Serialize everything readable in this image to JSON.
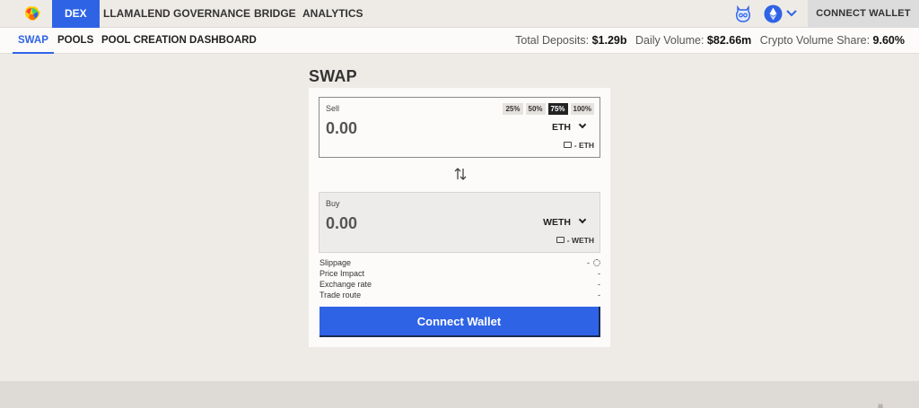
{
  "nav": {
    "items": [
      {
        "label": "DEX",
        "active": true
      },
      {
        "label": "LLAMALEND"
      },
      {
        "label": "GOVERNANCE"
      },
      {
        "label": "BRIDGE"
      },
      {
        "label": "ANALYTICS"
      }
    ],
    "connect_label": "CONNECT WALLET",
    "icons": [
      "llama-logo-icon",
      "theme-llama-icon",
      "ethereum-icon",
      "chevron-down-icon"
    ]
  },
  "subnav": {
    "items": [
      {
        "label": "SWAP",
        "active": true
      },
      {
        "label": "POOLS"
      },
      {
        "label": "POOL CREATION"
      },
      {
        "label": "DASHBOARD"
      }
    ],
    "stats": {
      "deposits_label": "Total Deposits:",
      "deposits_value": "$1.29b",
      "volume_label": "Daily Volume:",
      "volume_value": "$82.66m",
      "share_label": "Crypto Volume Share:",
      "share_value": "9.60%"
    }
  },
  "swap": {
    "title": "SWAP",
    "sell": {
      "label": "Sell",
      "amount": "0.00",
      "token": "ETH",
      "balance": "- ETH",
      "percents": [
        {
          "label": "25%"
        },
        {
          "label": "50%"
        },
        {
          "label": "75%",
          "selected": true
        },
        {
          "label": "100%"
        }
      ]
    },
    "switch_icon": "swap-arrows-icon",
    "buy": {
      "label": "Buy",
      "amount": "0.00",
      "token": "WETH",
      "balance": "- WETH"
    },
    "info": [
      {
        "label": "Slippage",
        "value": "-"
      },
      {
        "label": "Price Impact",
        "value": "-"
      },
      {
        "label": "Exchange rate",
        "value": "-"
      },
      {
        "label": "Trade route",
        "value": "-"
      }
    ],
    "cta_label": "Connect Wallet"
  },
  "colors": {
    "accent": "#2f63e6",
    "background": "#eeebe7",
    "panel": "#fcfbfa"
  }
}
